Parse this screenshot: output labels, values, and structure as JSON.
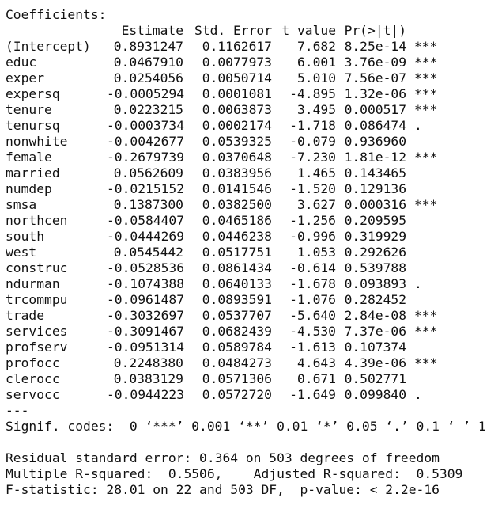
{
  "title": "Coefficients:",
  "headers": [
    "Estimate",
    "Std. Error",
    "t value",
    "Pr(>|t|)"
  ],
  "rows": [
    {
      "name": "(Intercept)",
      "estimate": "0.8931247",
      "std_error": "0.1162617",
      "t_value": "7.682",
      "p_value": "8.25e-14",
      "signif": "***"
    },
    {
      "name": "educ",
      "estimate": "0.0467910",
      "std_error": "0.0077973",
      "t_value": "6.001",
      "p_value": "3.76e-09",
      "signif": "***"
    },
    {
      "name": "exper",
      "estimate": "0.0254056",
      "std_error": "0.0050714",
      "t_value": "5.010",
      "p_value": "7.56e-07",
      "signif": "***"
    },
    {
      "name": "expersq",
      "estimate": "-0.0005294",
      "std_error": "0.0001081",
      "t_value": "-4.895",
      "p_value": "1.32e-06",
      "signif": "***"
    },
    {
      "name": "tenure",
      "estimate": "0.0223215",
      "std_error": "0.0063873",
      "t_value": "3.495",
      "p_value": "0.000517",
      "signif": "***"
    },
    {
      "name": "tenursq",
      "estimate": "-0.0003734",
      "std_error": "0.0002174",
      "t_value": "-1.718",
      "p_value": "0.086474",
      "signif": "."
    },
    {
      "name": "nonwhite",
      "estimate": "-0.0042677",
      "std_error": "0.0539325",
      "t_value": "-0.079",
      "p_value": "0.936960",
      "signif": ""
    },
    {
      "name": "female",
      "estimate": "-0.2679739",
      "std_error": "0.0370648",
      "t_value": "-7.230",
      "p_value": "1.81e-12",
      "signif": "***"
    },
    {
      "name": "married",
      "estimate": "0.0562609",
      "std_error": "0.0383956",
      "t_value": "1.465",
      "p_value": "0.143465",
      "signif": ""
    },
    {
      "name": "numdep",
      "estimate": "-0.0215152",
      "std_error": "0.0141546",
      "t_value": "-1.520",
      "p_value": "0.129136",
      "signif": ""
    },
    {
      "name": "smsa",
      "estimate": "0.1387300",
      "std_error": "0.0382500",
      "t_value": "3.627",
      "p_value": "0.000316",
      "signif": "***"
    },
    {
      "name": "northcen",
      "estimate": "-0.0584407",
      "std_error": "0.0465186",
      "t_value": "-1.256",
      "p_value": "0.209595",
      "signif": ""
    },
    {
      "name": "south",
      "estimate": "-0.0444269",
      "std_error": "0.0446238",
      "t_value": "-0.996",
      "p_value": "0.319929",
      "signif": ""
    },
    {
      "name": "west",
      "estimate": "0.0545442",
      "std_error": "0.0517751",
      "t_value": "1.053",
      "p_value": "0.292626",
      "signif": ""
    },
    {
      "name": "construc",
      "estimate": "-0.0528536",
      "std_error": "0.0861434",
      "t_value": "-0.614",
      "p_value": "0.539788",
      "signif": ""
    },
    {
      "name": "ndurman",
      "estimate": "-0.1074388",
      "std_error": "0.0640133",
      "t_value": "-1.678",
      "p_value": "0.093893",
      "signif": "."
    },
    {
      "name": "trcommpu",
      "estimate": "-0.0961487",
      "std_error": "0.0893591",
      "t_value": "-1.076",
      "p_value": "0.282452",
      "signif": ""
    },
    {
      "name": "trade",
      "estimate": "-0.3032697",
      "std_error": "0.0537707",
      "t_value": "-5.640",
      "p_value": "2.84e-08",
      "signif": "***"
    },
    {
      "name": "services",
      "estimate": "-0.3091467",
      "std_error": "0.0682439",
      "t_value": "-4.530",
      "p_value": "7.37e-06",
      "signif": "***"
    },
    {
      "name": "profserv",
      "estimate": "-0.0951314",
      "std_error": "0.0589784",
      "t_value": "-1.613",
      "p_value": "0.107374",
      "signif": ""
    },
    {
      "name": "profocc",
      "estimate": "0.2248380",
      "std_error": "0.0484273",
      "t_value": "4.643",
      "p_value": "4.39e-06",
      "signif": "***"
    },
    {
      "name": "clerocc",
      "estimate": "0.0383129",
      "std_error": "0.0571306",
      "t_value": "0.671",
      "p_value": "0.502771",
      "signif": ""
    },
    {
      "name": "servocc",
      "estimate": "-0.0944223",
      "std_error": "0.0572720",
      "t_value": "-1.649",
      "p_value": "0.099840",
      "signif": "."
    }
  ],
  "separator": "---",
  "signif_codes": "Signif. codes:  0 ‘***’ 0.001 ‘**’ 0.01 ‘*’ 0.05 ‘.’ 0.1 ‘ ’ 1",
  "footer": [
    "Residual standard error: 0.364 on 503 degrees of freedom",
    "Multiple R-squared:  0.5506,\tAdjusted R-squared:  0.5309",
    "F-statistic: 28.01 on 22 and 503 DF,  p-value: < 2.2e-16"
  ]
}
